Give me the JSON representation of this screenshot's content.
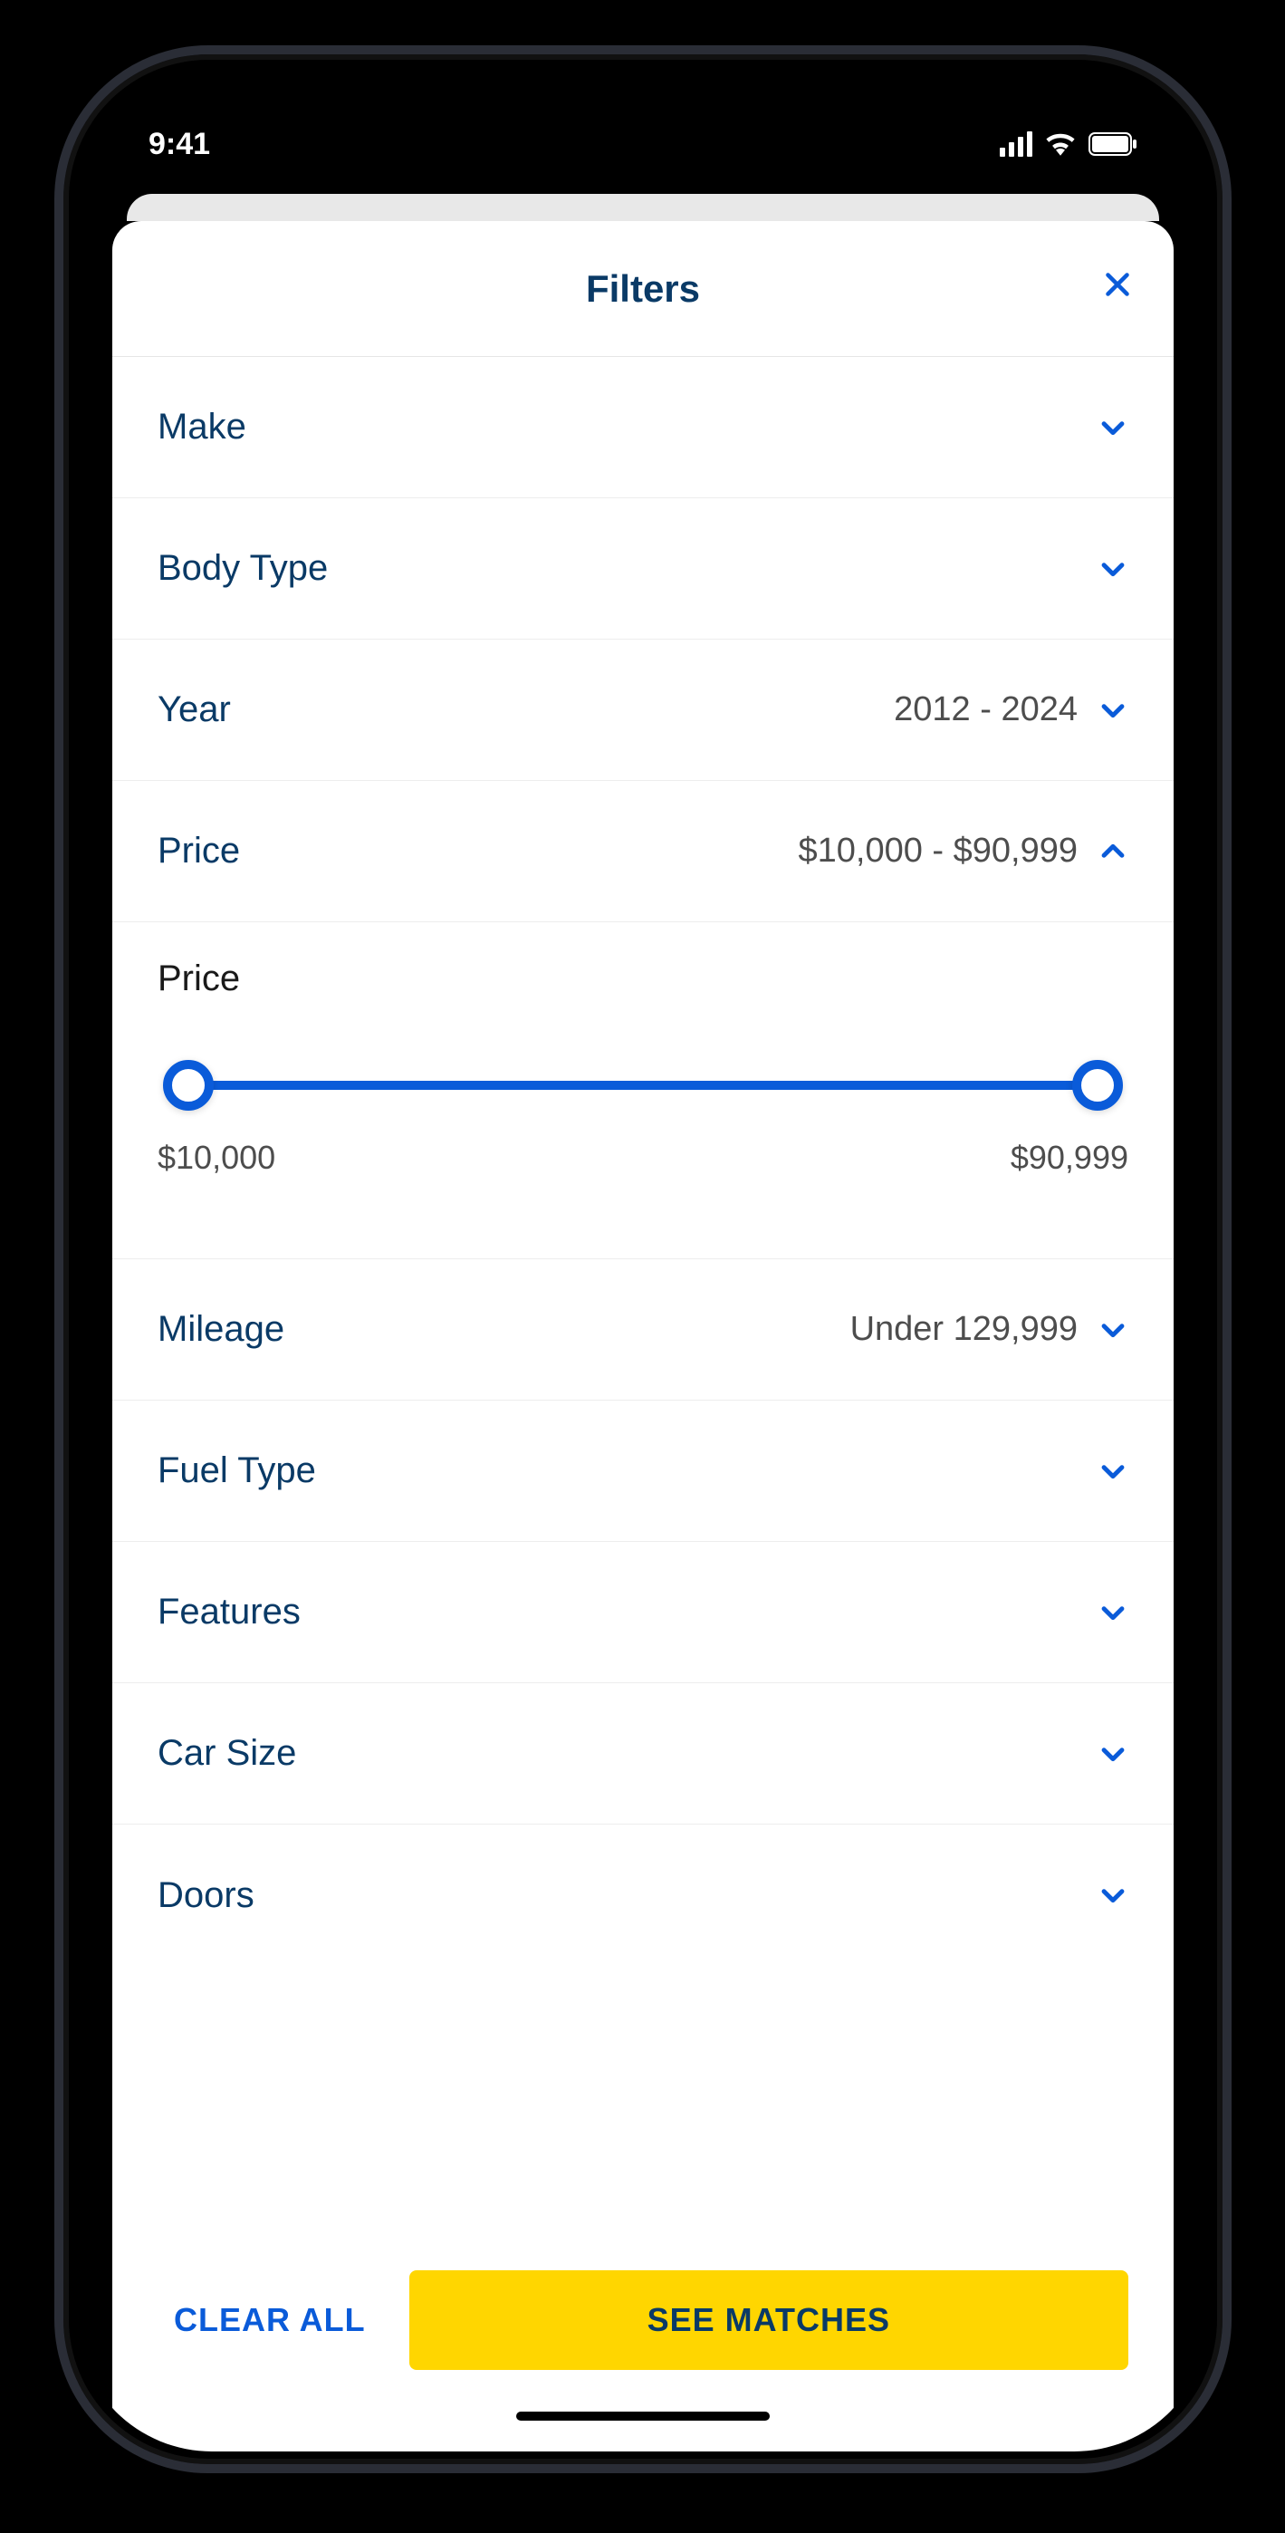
{
  "status": {
    "time": "9:41"
  },
  "header": {
    "title": "Filters"
  },
  "filters": [
    {
      "label": "Make",
      "value": "",
      "expanded": false
    },
    {
      "label": "Body Type",
      "value": "",
      "expanded": false
    },
    {
      "label": "Year",
      "value": "2012 - 2024",
      "expanded": false
    },
    {
      "label": "Price",
      "value": "$10,000 - $90,999",
      "expanded": true
    },
    {
      "label": "Mileage",
      "value": "Under 129,999",
      "expanded": false
    },
    {
      "label": "Fuel Type",
      "value": "",
      "expanded": false
    },
    {
      "label": "Features",
      "value": "",
      "expanded": false
    },
    {
      "label": "Car Size",
      "value": "",
      "expanded": false
    },
    {
      "label": "Doors",
      "value": "",
      "expanded": false
    }
  ],
  "price_slider": {
    "label": "Price",
    "min_label": "$10,000",
    "max_label": "$90,999",
    "min": 10000,
    "max": 90999
  },
  "footer": {
    "clear_label": "CLEAR ALL",
    "see_label": "SEE MATCHES"
  }
}
